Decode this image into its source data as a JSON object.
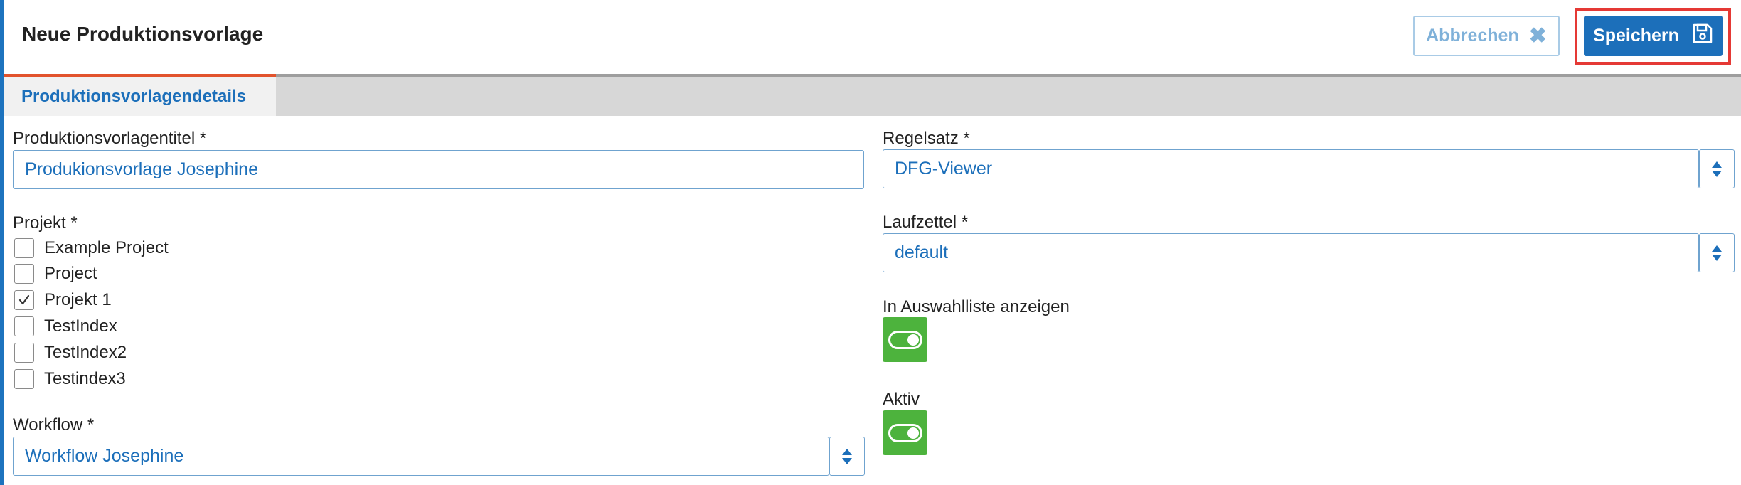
{
  "header": {
    "title": "Neue Produktionsvorlage",
    "cancel_label": "Abbrechen",
    "save_label": "Speichern"
  },
  "tabs": [
    {
      "label": "Produktionsvorlagendetails",
      "active": true
    }
  ],
  "form": {
    "title_field": {
      "label": "Produktionsvorlagentitel *",
      "value": "Produkionsvorlage Josephine"
    },
    "projects": {
      "label": "Projekt *",
      "items": [
        {
          "label": "Example Project",
          "checked": false
        },
        {
          "label": "Project",
          "checked": false
        },
        {
          "label": "Projekt 1",
          "checked": true
        },
        {
          "label": "TestIndex",
          "checked": false
        },
        {
          "label": "TestIndex2",
          "checked": false
        },
        {
          "label": "Testindex3",
          "checked": false
        }
      ]
    },
    "workflow": {
      "label": "Workflow *",
      "value": "Workflow Josephine"
    },
    "ruleset": {
      "label": "Regelsatz *",
      "value": "DFG-Viewer"
    },
    "docket": {
      "label": "Laufzettel *",
      "value": "default"
    },
    "show_in_selection": {
      "label": "In Auswahlliste anzeigen",
      "on": true
    },
    "active": {
      "label": "Aktiv",
      "on": true
    }
  },
  "colors": {
    "accent": "#1c6fba",
    "toggle_on": "#4db33d",
    "highlight": "#e53935",
    "tab_indicator": "#e2532d"
  }
}
